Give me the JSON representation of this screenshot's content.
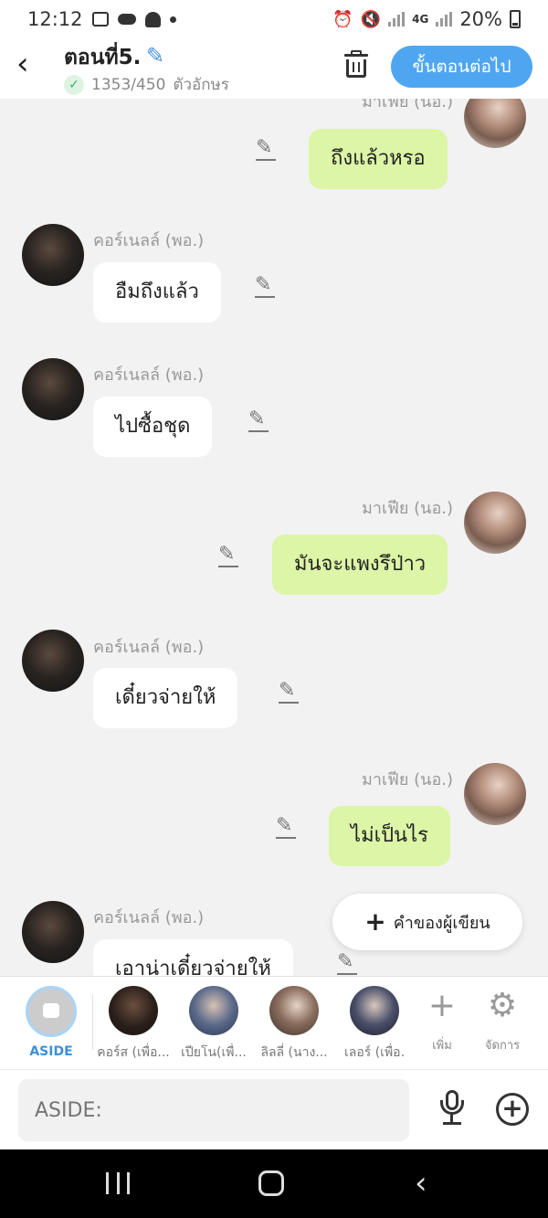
{
  "status_bar": {
    "time": "12:12",
    "network": "4G",
    "battery": "20%"
  },
  "header": {
    "back_icon": "chevron-left-icon",
    "title": "ตอนที่5.",
    "char_count": "1353/450",
    "char_unit": "ตัวอักษร",
    "next_label": "ขั้นตอนต่อไป"
  },
  "messages": [
    {
      "sender": "มาเฟีย (นอ.)",
      "text": "ถึงแล้วหรอ",
      "side": "right"
    },
    {
      "sender": "คอร์เนลล์ (พอ.)",
      "text": "อืมถึงแล้ว",
      "side": "left"
    },
    {
      "sender": "คอร์เนลล์ (พอ.)",
      "text": "ไปซื้อชุด",
      "side": "left"
    },
    {
      "sender": "มาเฟีย (นอ.)",
      "text": "มันจะแพงรึป่าว",
      "side": "right"
    },
    {
      "sender": "คอร์เนลล์ (พอ.)",
      "text": "เดี๋ยวจ่ายให้",
      "side": "left"
    },
    {
      "sender": "มาเฟีย (นอ.)",
      "text": "ไม่เป็นไร",
      "side": "right"
    },
    {
      "sender": "คอร์เนลล์ (พอ.)",
      "text": "เอาน่าเดี๋ยวจ่ายให้",
      "side": "left"
    }
  ],
  "writer_button": {
    "label": "คำของผู้เขียน"
  },
  "characters": {
    "aside": "ASIDE",
    "list": [
      "คอร์ส (เพื่อ...",
      "เปียโน(เพื่...",
      "ลิลลี่ (นาง...",
      "เลอร์ (เพื่อ."
    ],
    "add_label": "เพิ่ม",
    "manage_label": "จัดการ"
  },
  "input": {
    "placeholder": "ASIDE:"
  },
  "colors": {
    "accent": "#4fa6f0",
    "bubble_right": "#dcf5a6",
    "bubble_left": "#ffffff"
  }
}
